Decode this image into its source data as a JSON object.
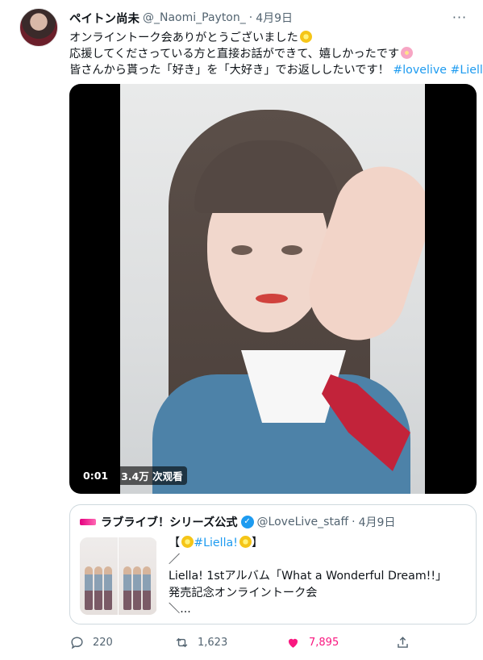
{
  "tweet": {
    "display_name": "ペイトン尚未",
    "handle": "@_Naomi_Payton_",
    "separator": "·",
    "date": "4月9日",
    "more": "···",
    "text_line1": "オンライントーク会ありがとうございました",
    "text_line2": "応援してくださっている方と直接お話ができて、嬉しかったです",
    "text_line3": "皆さんから貰った「好き」を「大好き」でお返ししたいです！",
    "hashtags": [
      "#lovelive",
      "#Liella"
    ]
  },
  "video": {
    "time": "0:01",
    "views": "3.4万 次观看"
  },
  "quote": {
    "display_name": "ラブライブ！シリーズ公式",
    "handle": "@LoveLive_staff",
    "separator": "·",
    "date": "4月9日",
    "line1_open": "【",
    "line1_tag": "#Liella!",
    "line1_close": "】",
    "line2": "／",
    "line3": "Liella! 1stアルバム「What a Wonderful Dream!!」",
    "line4": "発売記念オンライントーク会",
    "line5": "＼..."
  },
  "actions": {
    "reply_count": "220",
    "retweet_count": "1,623",
    "like_count": "7,895"
  },
  "colors": {
    "link": "#1d9bf0",
    "like": "#f91880",
    "secondary": "#536471"
  }
}
